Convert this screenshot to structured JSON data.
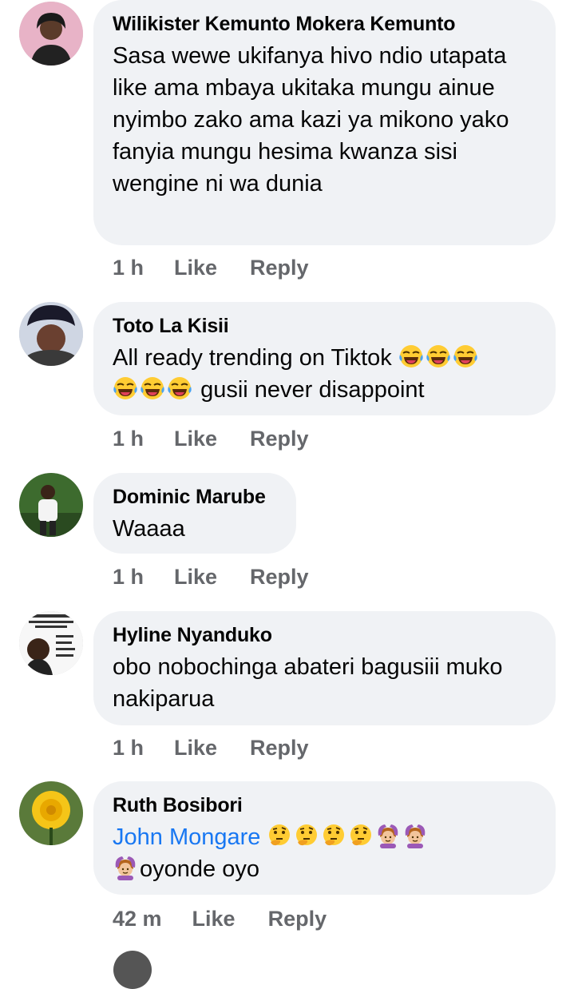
{
  "comments": [
    {
      "author": "Wilikister Kemunto Mokera Kemunto",
      "text": "Sasa wewe ukifanya hivo ndio utapata like ama mbaya ukitaka mungu ainue nyimbo zako ama kazi ya mikono yako fanyia mungu hesima kwanza sisi wengine ni wa dunia",
      "time": "1 h",
      "like": "Like",
      "reply": "Reply"
    },
    {
      "author": "Toto La Kisii",
      "text_before": "All ready trending on Tiktok",
      "text_after": "gusii never disappoint",
      "emojis": [
        "laughing-crying-emoji",
        "laughing-crying-emoji",
        "laughing-crying-emoji",
        "laughing-crying-emoji",
        "laughing-crying-emoji",
        "laughing-crying-emoji"
      ],
      "time": "1 h",
      "like": "Like",
      "reply": "Reply"
    },
    {
      "author": "Dominic Marube",
      "text": "Waaaa",
      "time": "1 h",
      "like": "Like",
      "reply": "Reply"
    },
    {
      "author": "Hyline Nyanduko",
      "text": "obo nobochinga abateri bagusiii muko nakiparua",
      "time": "1 h",
      "like": "Like",
      "reply": "Reply"
    },
    {
      "author": "Ruth Bosibori",
      "mention": "John Mongare",
      "text_after": "oyonde oyo",
      "emojis": [
        "thinking-face-emoji",
        "thinking-face-emoji",
        "thinking-face-emoji",
        "thinking-face-emoji",
        "person-gesturing-ok-emoji",
        "person-gesturing-ok-emoji",
        "person-gesturing-ok-emoji"
      ],
      "time": "42 m",
      "like": "Like",
      "reply": "Reply"
    }
  ],
  "colors": {
    "bubble": "#f0f2f5",
    "secondary_text": "#65676b",
    "mention": "#1877f2"
  }
}
